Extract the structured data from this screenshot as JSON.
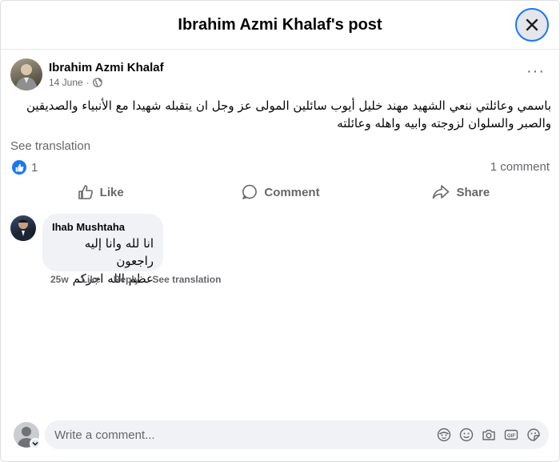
{
  "header": {
    "title": "Ibrahim Azmi Khalaf's post",
    "close_icon": "close-icon"
  },
  "post": {
    "author": "Ibrahim Azmi Khalaf",
    "date": "14 June",
    "date_separator": "·",
    "audience_icon": "globe-icon",
    "more_label": "···",
    "text_line1": "باسمي وعائلتي ننعي الشهيد مهند خليل أيوب سائلين المولى عز وجل ان يتقبله شهيدا مع الأنبياء والصديقين",
    "text_line2": "والصبر والسلوان لزوجته وابيه واهله وعائلته",
    "see_translation": "See translation",
    "reaction_count": "1",
    "comment_count": "1 comment"
  },
  "actions": {
    "like": "Like",
    "comment": "Comment",
    "share": "Share"
  },
  "comments": [
    {
      "author": "Ihab Mushtaha",
      "text_line1": "انا لله وانا إليه راجعون",
      "text_line2": "عظم الله اجركم",
      "age": "25w",
      "like": "Like",
      "reply": "Reply",
      "see_translation": "See translation"
    }
  ],
  "composer": {
    "placeholder": "Write a comment...",
    "icons": [
      "avatar-sticker-icon",
      "emoji-icon",
      "camera-icon",
      "gif-icon",
      "sticker-icon"
    ]
  },
  "colors": {
    "accent": "#1877f2",
    "muted": "#65676b",
    "bubble": "#f0f2f5"
  }
}
